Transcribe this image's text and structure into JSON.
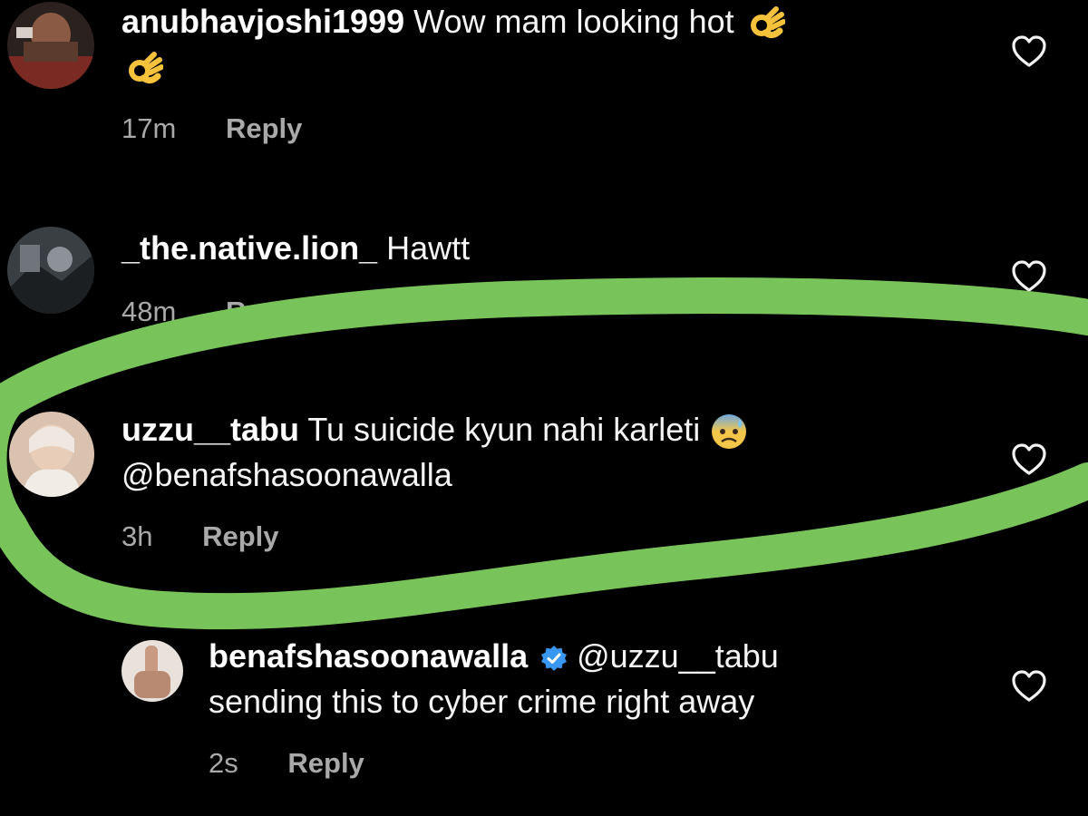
{
  "comments": [
    {
      "username": "anubhavjoshi1999",
      "text": "Wow mam looking hot",
      "emoji": "ok-hand-emoji",
      "time": "17m",
      "reply": "Reply"
    },
    {
      "username": "_the.native.lion_",
      "text": "Hawtt",
      "time": "48m",
      "reply": "Reply"
    },
    {
      "username": "uzzu__tabu",
      "text": "Tu suicide kyun nahi karleti",
      "emoji": "anxious-face-with-sweat-emoji",
      "mention": "@benafshasoonawalla",
      "time": "3h",
      "reply": "Reply"
    },
    {
      "username": "benafshasoonawalla",
      "verified": true,
      "mention": "@uzzu__tabu",
      "text": "sending this to cyber crime right away",
      "time": "2s",
      "reply": "Reply"
    }
  ],
  "colors": {
    "background": "#000000",
    "text": "#f4f4f4",
    "meta": "#a9a9a9",
    "highlight_marker": "#79c45a",
    "verified_badge": "#3897f0"
  },
  "icons": {
    "like": "heart-outline-icon",
    "verified": "verified-badge-icon"
  }
}
